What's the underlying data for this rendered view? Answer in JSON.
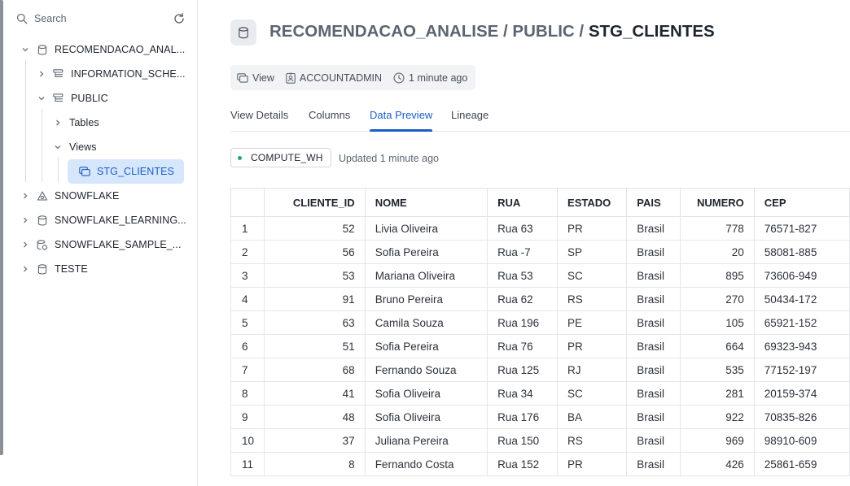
{
  "sidebar": {
    "search_placeholder": "Search",
    "tree": [
      {
        "label": "RECOMENDACAO_ANAL..."
      },
      {
        "label": "INFORMATION_SCHE..."
      },
      {
        "label": "PUBLIC"
      },
      {
        "label": "Tables"
      },
      {
        "label": "Views"
      },
      {
        "label": "STG_CLIENTES"
      },
      {
        "label": "SNOWFLAKE"
      },
      {
        "label": "SNOWFLAKE_LEARNING..."
      },
      {
        "label": "SNOWFLAKE_SAMPLE_..."
      },
      {
        "label": "TESTE"
      }
    ]
  },
  "header": {
    "crumb_prefix": "RECOMENDACAO_ANALISE / PUBLIC / ",
    "crumb_last": "STG_CLIENTES",
    "meta": {
      "type": "View",
      "owner": "ACCOUNTADMIN",
      "updated": "1 minute ago"
    }
  },
  "tabs": [
    {
      "label": "View Details"
    },
    {
      "label": "Columns"
    },
    {
      "label": "Data Preview"
    },
    {
      "label": "Lineage"
    }
  ],
  "active_tab": "Data Preview",
  "warehouse": {
    "name": "COMPUTE_WH",
    "status_color": "#27a567",
    "updated": "Updated 1 minute ago"
  },
  "table": {
    "columns": [
      "",
      "CLIENTE_ID",
      "NOME",
      "RUA",
      "ESTADO",
      "PAIS",
      "NUMERO",
      "CEP"
    ],
    "rows": [
      [
        "1",
        "52",
        "Livia Oliveira",
        "Rua 63",
        "PR",
        "Brasil",
        "778",
        "76571-827"
      ],
      [
        "2",
        "56",
        "Sofia Pereira",
        "Rua -7",
        "SP",
        "Brasil",
        "20",
        "58081-885"
      ],
      [
        "3",
        "53",
        "Mariana Oliveira",
        "Rua 53",
        "SC",
        "Brasil",
        "895",
        "73606-949"
      ],
      [
        "4",
        "91",
        "Bruno Pereira",
        "Rua 62",
        "RS",
        "Brasil",
        "270",
        "50434-172"
      ],
      [
        "5",
        "63",
        "Camila Souza",
        "Rua 196",
        "PE",
        "Brasil",
        "105",
        "65921-152"
      ],
      [
        "6",
        "51",
        "Sofia Pereira",
        "Rua 76",
        "PR",
        "Brasil",
        "664",
        "69323-943"
      ],
      [
        "7",
        "68",
        "Fernando Souza",
        "Rua 125",
        "RJ",
        "Brasil",
        "535",
        "77152-197"
      ],
      [
        "8",
        "41",
        "Sofia Oliveira",
        "Rua 34",
        "SC",
        "Brasil",
        "281",
        "20159-374"
      ],
      [
        "9",
        "48",
        "Sofia Oliveira",
        "Rua 176",
        "BA",
        "Brasil",
        "922",
        "70835-826"
      ],
      [
        "10",
        "37",
        "Juliana Pereira",
        "Rua 150",
        "RS",
        "Brasil",
        "969",
        "98910-609"
      ],
      [
        "11",
        "8",
        "Fernando Costa",
        "Rua 152",
        "PR",
        "Brasil",
        "426",
        "25861-659"
      ]
    ]
  },
  "colors": {
    "accent": "#1a5dc8",
    "selected_bg": "#d6e6fb"
  }
}
